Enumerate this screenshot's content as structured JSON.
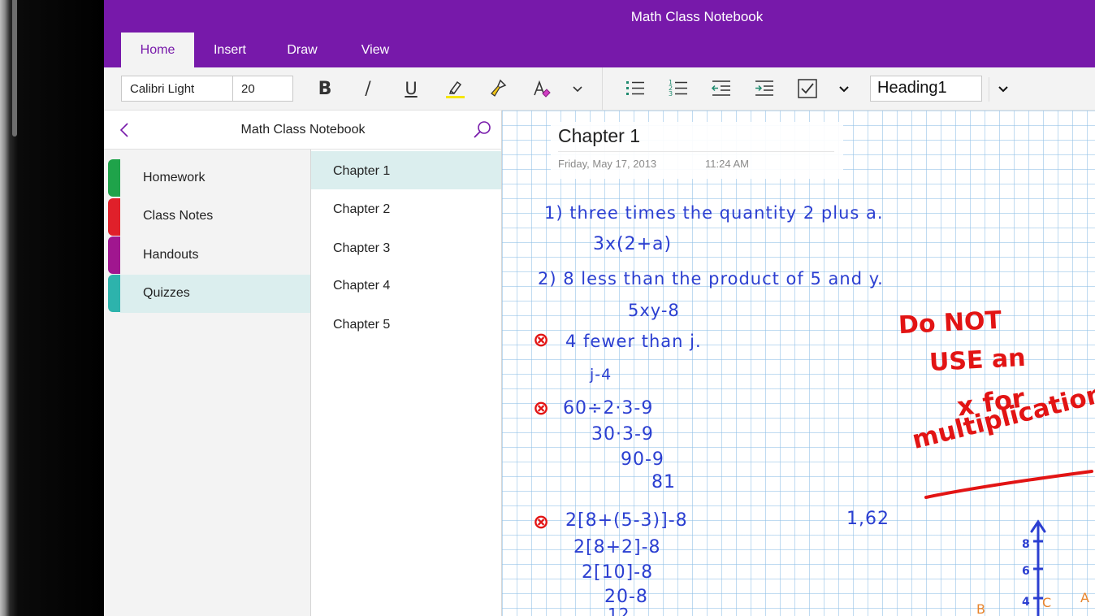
{
  "app": {
    "title": "Math Class Notebook"
  },
  "tabs": [
    {
      "label": "Home",
      "active": true
    },
    {
      "label": "Insert"
    },
    {
      "label": "Draw"
    },
    {
      "label": "View"
    }
  ],
  "ribbon": {
    "font_name": "Calibri Light",
    "font_size": "20",
    "style": "Heading1",
    "icons": [
      "bold-icon",
      "italic-icon",
      "underline-icon",
      "highlighter-icon",
      "format-painter-icon",
      "clear-formatting-icon",
      "chevron-down-icon",
      "bullet-list-icon",
      "numbered-list-icon",
      "outdent-icon",
      "indent-icon",
      "checkbox-icon",
      "chevron-down-icon"
    ]
  },
  "nav": {
    "title": "Math Class Notebook"
  },
  "sections": [
    {
      "label": "Homework",
      "color": "#1fa34a"
    },
    {
      "label": "Class Notes",
      "color": "#e0202a"
    },
    {
      "label": "Handouts",
      "color": "#a0168f"
    },
    {
      "label": "Quizzes",
      "color": "#2db3ac",
      "active": true
    }
  ],
  "pages": [
    {
      "label": "Chapter 1",
      "active": true
    },
    {
      "label": "Chapter 2"
    },
    {
      "label": "Chapter 3"
    },
    {
      "label": "Chapter 4"
    },
    {
      "label": "Chapter 5"
    }
  ],
  "page": {
    "title": "Chapter 1",
    "date": "Friday, May 17, 2013",
    "time": "11:24 AM"
  },
  "ink": {
    "q1": "1) three times the quantity 2 plus a.",
    "a1": "3x(2+a)",
    "q2": "2) 8 less than the product of 5 and y.",
    "a2": "5xy-8",
    "q3": "4 fewer than j.",
    "a3": "j-4",
    "q4": "60÷2·3-9",
    "a4_1": "30·3-9",
    "a4_2": "90-9",
    "a4_3": "81",
    "q5": "2[8+(5-3)]-8",
    "a5_1": "2[8+2]-8",
    "a5_2": "2[10]-8",
    "a5_3": "20-8",
    "side": "1,62",
    "note_line1": "Do NOT",
    "note_line2": "USE an",
    "note_line3": "x for",
    "note_line4": "multiplication",
    "axis_8": "8",
    "axis_6": "6",
    "axis_4": "4",
    "label_c": "C",
    "label_a": "A",
    "label_b": "B",
    "ink_blue": "#2b3fd1",
    "ink_red": "#e21414"
  }
}
